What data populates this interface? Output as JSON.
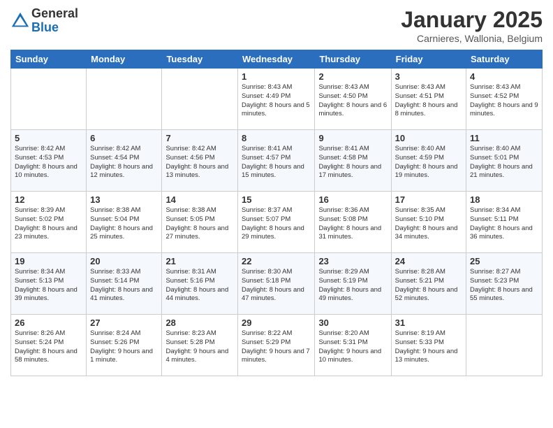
{
  "logo": {
    "general": "General",
    "blue": "Blue"
  },
  "title": "January 2025",
  "subtitle": "Carnieres, Wallonia, Belgium",
  "days_header": [
    "Sunday",
    "Monday",
    "Tuesday",
    "Wednesday",
    "Thursday",
    "Friday",
    "Saturday"
  ],
  "weeks": [
    [
      {
        "day": "",
        "info": ""
      },
      {
        "day": "",
        "info": ""
      },
      {
        "day": "",
        "info": ""
      },
      {
        "day": "1",
        "info": "Sunrise: 8:43 AM\nSunset: 4:49 PM\nDaylight: 8 hours\nand 5 minutes."
      },
      {
        "day": "2",
        "info": "Sunrise: 8:43 AM\nSunset: 4:50 PM\nDaylight: 8 hours\nand 6 minutes."
      },
      {
        "day": "3",
        "info": "Sunrise: 8:43 AM\nSunset: 4:51 PM\nDaylight: 8 hours\nand 8 minutes."
      },
      {
        "day": "4",
        "info": "Sunrise: 8:43 AM\nSunset: 4:52 PM\nDaylight: 8 hours\nand 9 minutes."
      }
    ],
    [
      {
        "day": "5",
        "info": "Sunrise: 8:42 AM\nSunset: 4:53 PM\nDaylight: 8 hours\nand 10 minutes."
      },
      {
        "day": "6",
        "info": "Sunrise: 8:42 AM\nSunset: 4:54 PM\nDaylight: 8 hours\nand 12 minutes."
      },
      {
        "day": "7",
        "info": "Sunrise: 8:42 AM\nSunset: 4:56 PM\nDaylight: 8 hours\nand 13 minutes."
      },
      {
        "day": "8",
        "info": "Sunrise: 8:41 AM\nSunset: 4:57 PM\nDaylight: 8 hours\nand 15 minutes."
      },
      {
        "day": "9",
        "info": "Sunrise: 8:41 AM\nSunset: 4:58 PM\nDaylight: 8 hours\nand 17 minutes."
      },
      {
        "day": "10",
        "info": "Sunrise: 8:40 AM\nSunset: 4:59 PM\nDaylight: 8 hours\nand 19 minutes."
      },
      {
        "day": "11",
        "info": "Sunrise: 8:40 AM\nSunset: 5:01 PM\nDaylight: 8 hours\nand 21 minutes."
      }
    ],
    [
      {
        "day": "12",
        "info": "Sunrise: 8:39 AM\nSunset: 5:02 PM\nDaylight: 8 hours\nand 23 minutes."
      },
      {
        "day": "13",
        "info": "Sunrise: 8:38 AM\nSunset: 5:04 PM\nDaylight: 8 hours\nand 25 minutes."
      },
      {
        "day": "14",
        "info": "Sunrise: 8:38 AM\nSunset: 5:05 PM\nDaylight: 8 hours\nand 27 minutes."
      },
      {
        "day": "15",
        "info": "Sunrise: 8:37 AM\nSunset: 5:07 PM\nDaylight: 8 hours\nand 29 minutes."
      },
      {
        "day": "16",
        "info": "Sunrise: 8:36 AM\nSunset: 5:08 PM\nDaylight: 8 hours\nand 31 minutes."
      },
      {
        "day": "17",
        "info": "Sunrise: 8:35 AM\nSunset: 5:10 PM\nDaylight: 8 hours\nand 34 minutes."
      },
      {
        "day": "18",
        "info": "Sunrise: 8:34 AM\nSunset: 5:11 PM\nDaylight: 8 hours\nand 36 minutes."
      }
    ],
    [
      {
        "day": "19",
        "info": "Sunrise: 8:34 AM\nSunset: 5:13 PM\nDaylight: 8 hours\nand 39 minutes."
      },
      {
        "day": "20",
        "info": "Sunrise: 8:33 AM\nSunset: 5:14 PM\nDaylight: 8 hours\nand 41 minutes."
      },
      {
        "day": "21",
        "info": "Sunrise: 8:31 AM\nSunset: 5:16 PM\nDaylight: 8 hours\nand 44 minutes."
      },
      {
        "day": "22",
        "info": "Sunrise: 8:30 AM\nSunset: 5:18 PM\nDaylight: 8 hours\nand 47 minutes."
      },
      {
        "day": "23",
        "info": "Sunrise: 8:29 AM\nSunset: 5:19 PM\nDaylight: 8 hours\nand 49 minutes."
      },
      {
        "day": "24",
        "info": "Sunrise: 8:28 AM\nSunset: 5:21 PM\nDaylight: 8 hours\nand 52 minutes."
      },
      {
        "day": "25",
        "info": "Sunrise: 8:27 AM\nSunset: 5:23 PM\nDaylight: 8 hours\nand 55 minutes."
      }
    ],
    [
      {
        "day": "26",
        "info": "Sunrise: 8:26 AM\nSunset: 5:24 PM\nDaylight: 8 hours\nand 58 minutes."
      },
      {
        "day": "27",
        "info": "Sunrise: 8:24 AM\nSunset: 5:26 PM\nDaylight: 9 hours\nand 1 minute."
      },
      {
        "day": "28",
        "info": "Sunrise: 8:23 AM\nSunset: 5:28 PM\nDaylight: 9 hours\nand 4 minutes."
      },
      {
        "day": "29",
        "info": "Sunrise: 8:22 AM\nSunset: 5:29 PM\nDaylight: 9 hours\nand 7 minutes."
      },
      {
        "day": "30",
        "info": "Sunrise: 8:20 AM\nSunset: 5:31 PM\nDaylight: 9 hours\nand 10 minutes."
      },
      {
        "day": "31",
        "info": "Sunrise: 8:19 AM\nSunset: 5:33 PM\nDaylight: 9 hours\nand 13 minutes."
      },
      {
        "day": "",
        "info": ""
      }
    ]
  ]
}
